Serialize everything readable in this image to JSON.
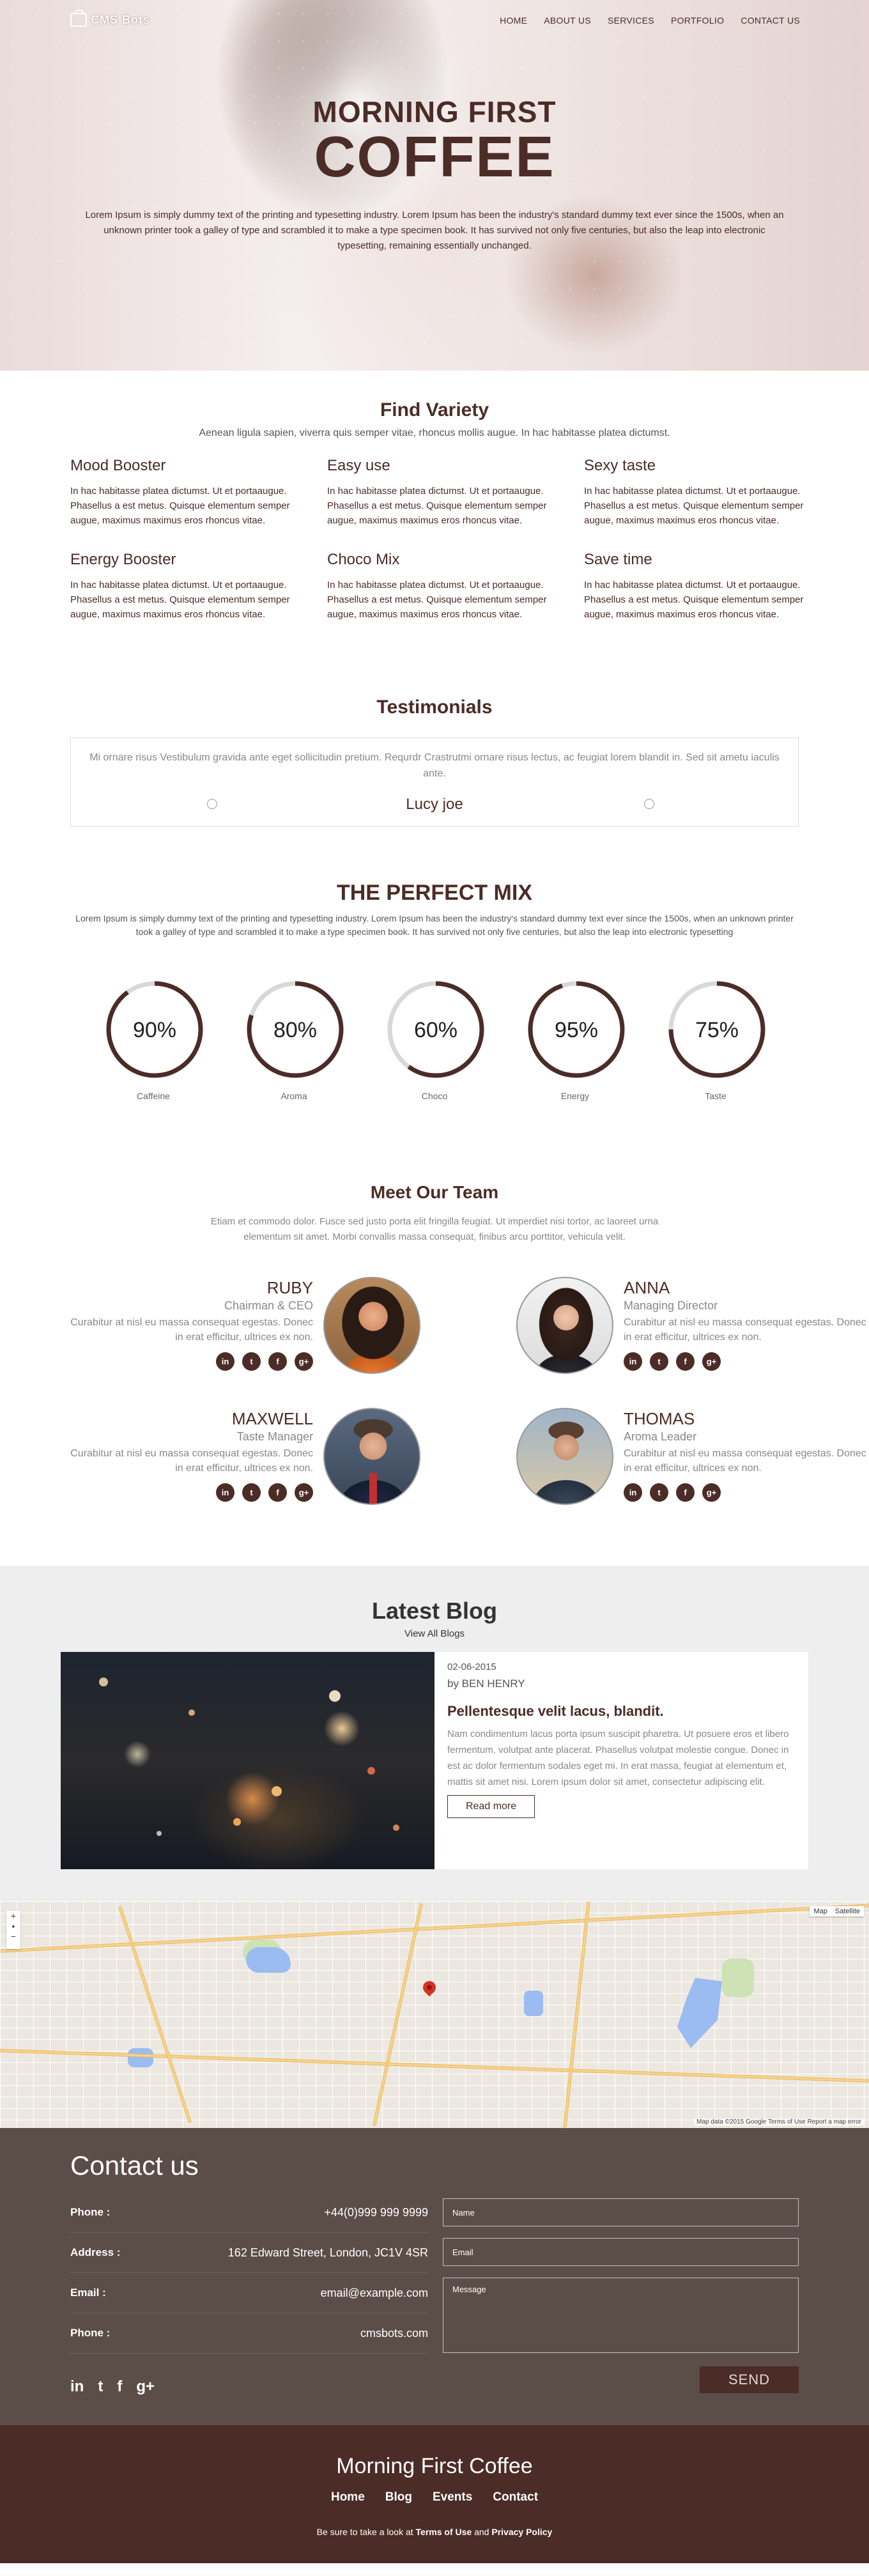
{
  "brand": {
    "logo_text": "CMS Bots"
  },
  "nav": {
    "items": [
      "HOME",
      "ABOUT US",
      "SERVICES",
      "PORTFOLIO",
      "CONTACT US"
    ]
  },
  "hero": {
    "title_line1": "MORNING FIRST",
    "title_line2": "COFFEE",
    "text": "Lorem Ipsum is simply dummy text of the printing and typesetting industry. Lorem Ipsum has been the industry's standard dummy text ever since the 1500s, when an unknown printer took a galley of type and scrambled it to make a type specimen book. It has survived not only five centuries, but also the leap into electronic typesetting, remaining essentially unchanged."
  },
  "variety": {
    "title": "Find Variety",
    "subtitle": "Aenean ligula sapien, viverra quis semper vitae, rhoncus mollis augue. In hac habitasse platea dictumst.",
    "items": [
      {
        "title": "Mood Booster",
        "text": "In hac habitasse platea dictumst. Ut et portaaugue. Phasellus a est metus. Quisque elementum semper augue, maximus maximus eros rhoncus vitae."
      },
      {
        "title": "Easy use",
        "text": "In hac habitasse platea dictumst. Ut et portaaugue. Phasellus a est metus. Quisque elementum semper augue, maximus maximus eros rhoncus vitae."
      },
      {
        "title": "Sexy taste",
        "text": "In hac habitasse platea dictumst. Ut et portaaugue. Phasellus a est metus. Quisque elementum semper augue, maximus maximus eros rhoncus vitae."
      },
      {
        "title": "Energy Booster",
        "text": "In hac habitasse platea dictumst. Ut et portaaugue. Phasellus a est metus. Quisque elementum semper augue, maximus maximus eros rhoncus vitae."
      },
      {
        "title": "Choco Mix",
        "text": "In hac habitasse platea dictumst. Ut et portaaugue. Phasellus a est metus. Quisque elementum semper augue, maximus maximus eros rhoncus vitae."
      },
      {
        "title": "Save time",
        "text": "In hac habitasse platea dictumst. Ut et portaaugue. Phasellus a est metus. Quisque elementum semper augue, maximus maximus eros rhoncus vitae."
      }
    ]
  },
  "testimonials": {
    "title": "Testimonials",
    "quote": "Mi ornare risus Vestibulum gravida ante eget sollicitudin pretium. Requrdr Crastrutmi ornare risus lectus, ac feugiat lorem blandit in. Sed sit ametu iaculis ante.",
    "author": "Lucy joe"
  },
  "mix": {
    "title": "THE PERFECT MIX",
    "text": "Lorem Ipsum is simply dummy text of the printing and typesetting industry. Lorem Ipsum has been the industry's standard dummy text ever since the 1500s, when an unknown printer took a galley of type and scrambled it to make a type specimen book. It has survived not only five centuries, but also the leap into electronic typesetting",
    "dials": [
      {
        "label": "Caffeine",
        "value": 90,
        "display": "90%"
      },
      {
        "label": "Aroma",
        "value": 80,
        "display": "80%"
      },
      {
        "label": "Choco",
        "value": 60,
        "display": "60%"
      },
      {
        "label": "Energy",
        "value": 95,
        "display": "95%"
      },
      {
        "label": "Taste",
        "value": 75,
        "display": "75%"
      }
    ]
  },
  "team": {
    "title": "Meet Our Team",
    "subtitle": "Etiam et commodo dolor. Fusce sed justo porta elit fringilla feugiat. Ut imperdiet nisi tortor, ac laoreet urna elementum sit amet. Morbi convallis massa consequat, finibus arcu porttitor, vehicula velit.",
    "members": [
      {
        "name": "RUBY",
        "role": "Chairman & CEO",
        "desc": "Curabitur at nisl eu massa consequat egestas. Donec in erat efficitur, ultrices ex non."
      },
      {
        "name": "ANNA",
        "role": "Managing Director",
        "desc": "Curabitur at nisl eu massa consequat egestas. Donec in erat efficitur, ultrices ex non."
      },
      {
        "name": "MAXWELL",
        "role": "Taste Manager",
        "desc": "Curabitur at nisl eu massa consequat egestas. Donec in erat efficitur, ultrices ex non."
      },
      {
        "name": "THOMAS",
        "role": "Aroma Leader",
        "desc": "Curabitur at nisl eu massa consequat egestas. Donec in erat efficitur, ultrices ex non."
      }
    ],
    "social_icons": [
      "linkedin-icon",
      "twitter-icon",
      "facebook-icon",
      "google-plus-icon"
    ]
  },
  "blog": {
    "title": "Latest Blog",
    "view_all": "View All Blogs",
    "post": {
      "date": "02-06-2015",
      "author": "by BEN HENRY",
      "title": "Pellentesque velit lacus, blandit.",
      "text": "Nam condimentum lacus porta ipsum suscipit pharetra. Ut posuere eros et libero fermentum, volutpat ante placerat. Phasellus volutpat molestie congue. Donec in est ac dolor fermentum sodales eget mi. In erat massa, feugiat at elementum et, mattis sit amet nisi. Lorem ipsum dolor sit amet, consectetur adipiscing elit.",
      "read_more": "Read more"
    }
  },
  "map": {
    "type_map": "Map",
    "type_satellite": "Satellite",
    "copyright": "Map data ©2015 Google   Terms of Use   Report a map error"
  },
  "contact": {
    "title": "Contact us",
    "rows": [
      {
        "key": "Phone :",
        "value": "+44(0)999 999 9999"
      },
      {
        "key": "Address :",
        "value": "162 Edward Street, London, JC1V 4SR"
      },
      {
        "key": "Email :",
        "value": "email@example.com"
      },
      {
        "key": "Phone :",
        "value": "cmsbots.com"
      }
    ],
    "form": {
      "name_placeholder": "Name",
      "email_placeholder": "Email",
      "message_placeholder": "Message",
      "send_label": "SEND"
    }
  },
  "footer": {
    "title": "Morning First Coffee",
    "nav": [
      "Home",
      "Blog",
      "Events",
      "Contact"
    ],
    "note_prefix": "Be sure to take a look at",
    "terms": "Terms of Use",
    "and": "and",
    "privacy": "Privacy Policy"
  },
  "colors": {
    "brand": "#4b2c26",
    "contact_bg": "#5b4d48",
    "ring_track": "#d8d8d8"
  }
}
